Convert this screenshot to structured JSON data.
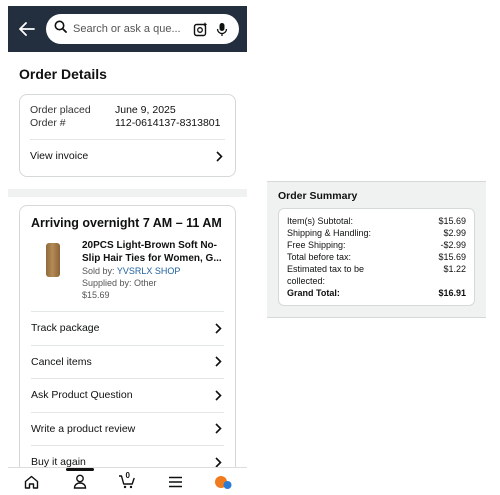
{
  "search": {
    "placeholder": "Search or ask a que..."
  },
  "order_details": {
    "title": "Order Details",
    "order_placed_label": "Order placed",
    "order_placed_value": "June 9, 2025",
    "order_number_label": "Order #",
    "order_number_value": "112-0614137-8313801",
    "view_invoice": "View invoice"
  },
  "shipment": {
    "heading": "Arriving overnight 7 AM – 11 AM",
    "item": {
      "title": "20PCS Light-Brown Soft No-Slip Hair Ties for Women, G...",
      "sold_by_label": "Sold by: ",
      "seller": "YVSRLX SHOP",
      "supplied_by": "Supplied by: Other",
      "price": "$15.69"
    },
    "actions": [
      "Track package",
      "Cancel items",
      "Ask Product Question",
      "Write a product review",
      "Buy it again"
    ]
  },
  "bottom_nav": {
    "cart_count": "0"
  },
  "summary": {
    "title": "Order Summary",
    "rows": [
      {
        "label": "Item(s) Subtotal:",
        "value": "$15.69"
      },
      {
        "label": "Shipping & Handling:",
        "value": "$2.99"
      },
      {
        "label": "Free Shipping:",
        "value": "-$2.99"
      },
      {
        "label": "Total before tax:",
        "value": "$15.69"
      },
      {
        "label": "Estimated tax to be collected:",
        "value": "$1.22"
      }
    ],
    "grand_total_label": "Grand Total:",
    "grand_total_value": "$16.91"
  },
  "colors": {
    "header_bg": "#232f3e",
    "link": "#2162a1",
    "panel_bg": "#f0f2f2",
    "alexa_orange": "#f07b1e",
    "alexa_blue": "#2a7bd6"
  }
}
